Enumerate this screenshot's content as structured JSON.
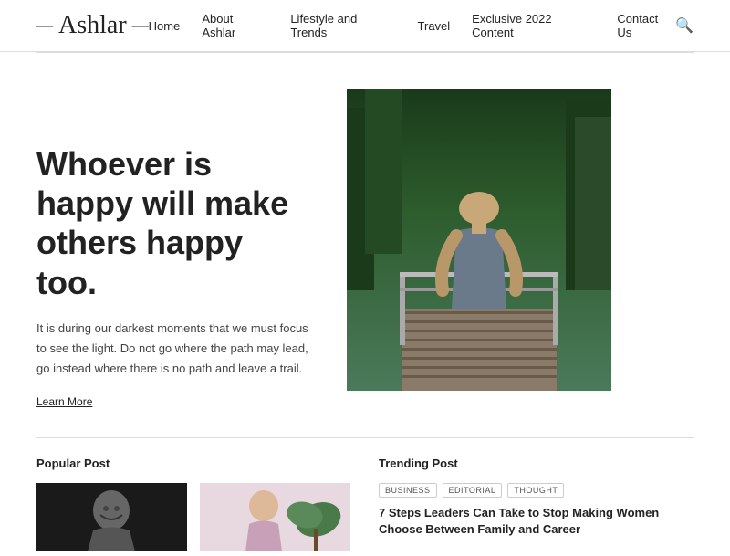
{
  "header": {
    "logo_prefix": "—",
    "logo_text": "Ashlar",
    "logo_suffix": "—",
    "nav": [
      {
        "label": "Home",
        "id": "home"
      },
      {
        "label": "About Ashlar",
        "id": "about"
      },
      {
        "label": "Lifestyle and Trends",
        "id": "lifestyle"
      },
      {
        "label": "Travel",
        "id": "travel"
      },
      {
        "label": "Exclusive 2022 Content",
        "id": "exclusive"
      },
      {
        "label": "Contact Us",
        "id": "contact"
      }
    ]
  },
  "hero": {
    "title": "Whoever is happy will make others happy too.",
    "description": "It is during our darkest moments that we must focus to see the light. Do not go where the path may lead, go instead where there is no path and leave a trail.",
    "link_label": "Learn More"
  },
  "sections": {
    "popular_label": "Popular Post",
    "trending_label": "Trending Post"
  },
  "trending": {
    "tags": [
      "BUSINESS",
      "EDITORIAL",
      "THOUGHT"
    ],
    "title": "7 Steps Leaders Can Take to Stop Making Women Choose Between Family and Career"
  }
}
